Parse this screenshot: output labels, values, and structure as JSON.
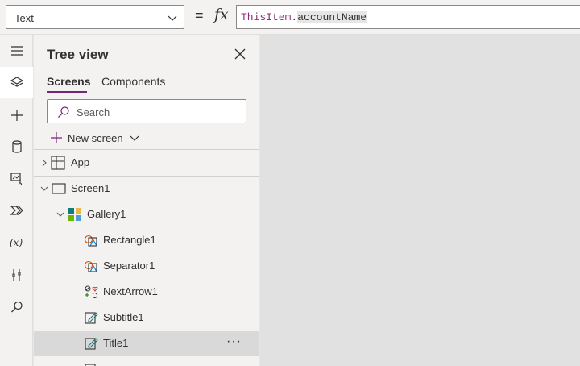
{
  "formula_bar": {
    "property": "Text",
    "equals": "=",
    "fx": "fx",
    "formula_keyword": "ThisItem",
    "formula_dot": ".",
    "formula_field": "accountName"
  },
  "rail": {
    "items": [
      "hamburger-menu",
      "tree-view",
      "insert",
      "data",
      "media",
      "power-automate",
      "variables",
      "advanced-tools",
      "search"
    ]
  },
  "tree_panel": {
    "title": "Tree view",
    "tabs": [
      "Screens",
      "Components"
    ],
    "search_placeholder": "Search",
    "new_screen_label": "New screen",
    "nodes": [
      {
        "label": "App",
        "icon": "app-icon",
        "expander": "collapsed"
      },
      {
        "label": "Screen1",
        "icon": "screen-icon",
        "expander": "expanded"
      },
      {
        "label": "Gallery1",
        "icon": "gallery-icon",
        "expander": "expanded"
      },
      {
        "label": "Rectangle1",
        "icon": "shape-icon",
        "expander": "none"
      },
      {
        "label": "Separator1",
        "icon": "shape-icon",
        "expander": "none"
      },
      {
        "label": "NextArrow1",
        "icon": "icon-control-icon",
        "expander": "none"
      },
      {
        "label": "Subtitle1",
        "icon": "label-edit-icon",
        "expander": "none"
      },
      {
        "label": "Title1",
        "icon": "label-edit-icon",
        "expander": "none",
        "selected": true,
        "more": "···"
      }
    ]
  },
  "colors": {
    "accent": "#742774",
    "formula_keyword": "#8b2f74",
    "panel_bg": "#f3f2f1",
    "canvas_bg": "#e1e1e1",
    "selected_row": "#d9d9d9"
  }
}
